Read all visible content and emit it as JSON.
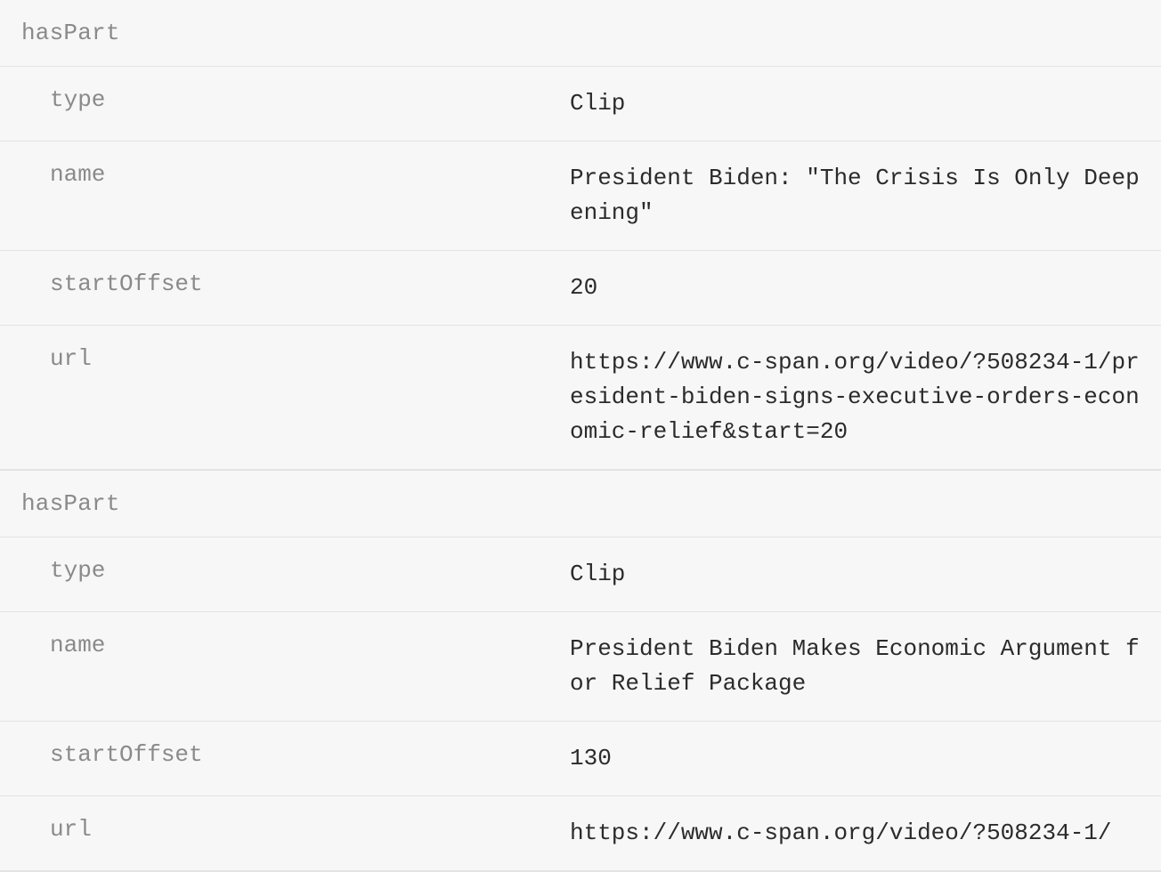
{
  "sections": [
    {
      "header": "hasPart",
      "rows": [
        {
          "key": "type",
          "value": "Clip"
        },
        {
          "key": "name",
          "value": "President Biden: \"The Crisis Is Only Deepening\""
        },
        {
          "key": "startOffset",
          "value": "20"
        },
        {
          "key": "url",
          "value": "https://www.c-span.org/video/?508234-1/president-biden-signs-executive-orders-economic-relief&start=20"
        }
      ]
    },
    {
      "header": "hasPart",
      "rows": [
        {
          "key": "type",
          "value": "Clip"
        },
        {
          "key": "name",
          "value": "President Biden Makes Economic Argument for Relief Package"
        },
        {
          "key": "startOffset",
          "value": "130"
        },
        {
          "key": "url",
          "value": "https://www.c-span.org/video/?508234-1/"
        }
      ]
    }
  ]
}
